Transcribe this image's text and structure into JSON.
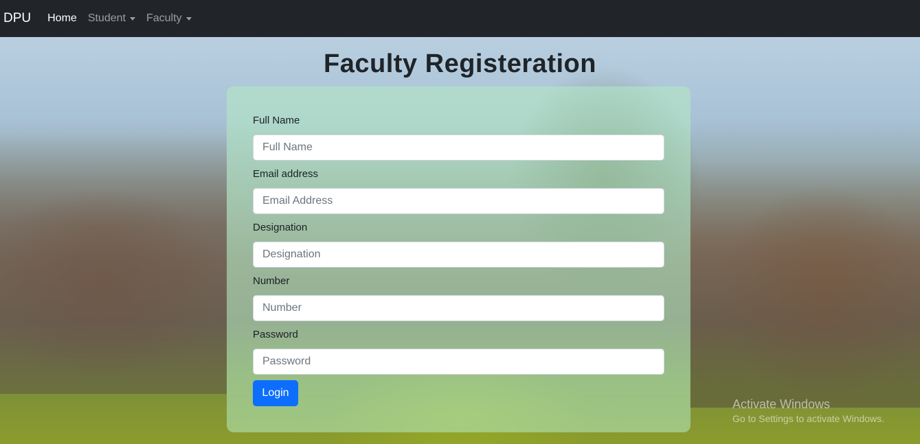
{
  "navbar": {
    "brand": "DPU",
    "items": [
      {
        "label": "Home",
        "active": true,
        "dropdown": false
      },
      {
        "label": "Student",
        "active": false,
        "dropdown": true
      },
      {
        "label": "Faculty",
        "active": false,
        "dropdown": true
      }
    ]
  },
  "page": {
    "title": "Faculty Registeration"
  },
  "form": {
    "fields": [
      {
        "label": "Full Name",
        "placeholder": "Full Name",
        "value": ""
      },
      {
        "label": "Email address",
        "placeholder": "Email Address",
        "value": ""
      },
      {
        "label": "Designation",
        "placeholder": "Designation",
        "value": ""
      },
      {
        "label": "Number",
        "placeholder": "Number",
        "value": ""
      },
      {
        "label": "Password",
        "placeholder": "Password",
        "value": ""
      }
    ],
    "submit_label": "Login"
  },
  "watermark": {
    "title": "Activate Windows",
    "subtitle": "Go to Settings to activate Windows."
  },
  "colors": {
    "navbar_bg": "#212529",
    "primary_button": "#0d6efd",
    "card_tint": "#b4ebc3"
  }
}
